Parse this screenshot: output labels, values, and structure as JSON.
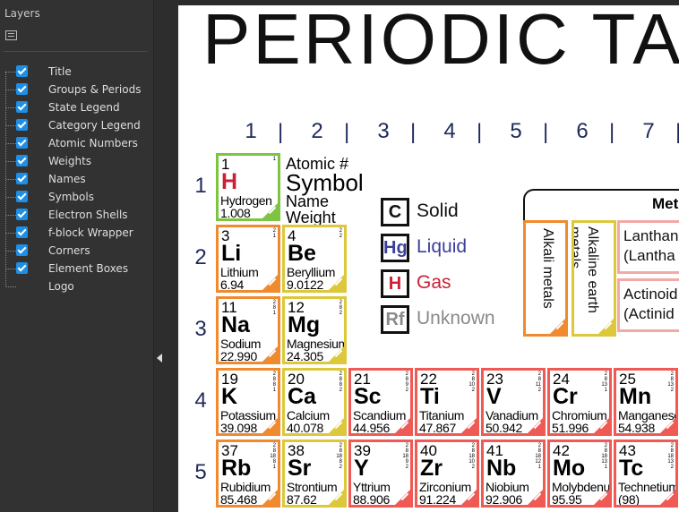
{
  "panel": {
    "title": "Layers",
    "menu_icon": "list-menu-icon",
    "layers": [
      {
        "label": "Title",
        "checked": true
      },
      {
        "label": "Groups & Periods",
        "checked": true
      },
      {
        "label": "State Legend",
        "checked": true
      },
      {
        "label": "Category Legend",
        "checked": true
      },
      {
        "label": "Atomic Numbers",
        "checked": true
      },
      {
        "label": "Weights",
        "checked": true
      },
      {
        "label": "Names",
        "checked": true
      },
      {
        "label": "Symbols",
        "checked": true
      },
      {
        "label": "Electron Shells",
        "checked": true
      },
      {
        "label": "f-block Wrapper",
        "checked": true
      },
      {
        "label": "Corners",
        "checked": true
      },
      {
        "label": "Element Boxes",
        "checked": true
      },
      {
        "label": "Logo",
        "checked": false
      }
    ]
  },
  "splitter": {
    "icon": "collapse-left-arrow-icon"
  },
  "document": {
    "title": "PERIODIC TA",
    "groups": [
      "1",
      "2",
      "3",
      "4",
      "5",
      "6",
      "7"
    ],
    "periods": [
      "1",
      "2",
      "3",
      "4",
      "5"
    ],
    "key": {
      "number": "Atomic #",
      "symbol": "Symbol",
      "name": "Name",
      "weight": "Weight"
    },
    "states": [
      {
        "symbol": "C",
        "label": "Solid",
        "color": "#111111"
      },
      {
        "symbol": "Hg",
        "label": "Liquid",
        "color": "#3b3f9a"
      },
      {
        "symbol": "H",
        "label": "Gas",
        "color": "#cc1f35"
      },
      {
        "symbol": "Rf",
        "label": "Unknown",
        "color": "#8a8a8a"
      }
    ],
    "categories": {
      "header": "Met",
      "alkali": "Alkali metals",
      "alkaline": "Alkaline earth metals",
      "lanthanoids": [
        "Lanthan",
        "(Lantha"
      ],
      "actinoids": [
        "Actinoid",
        "(Actinid"
      ]
    },
    "colors": {
      "alkali": "#f08a2e",
      "alkaline": "#dcc83a",
      "transition": "#ef5a55",
      "nonmetal": "#7cc442",
      "gas": "#cc1f35",
      "group_text": "#1e2a5a"
    },
    "elements": [
      {
        "num": "1",
        "sym": "H",
        "name": "Hydrogen",
        "weight": "1.008",
        "shells": [
          "1"
        ],
        "cat": "nonmetal",
        "gas": true
      },
      {
        "num": "3",
        "sym": "Li",
        "name": "Lithium",
        "weight": "6.94",
        "shells": [
          "2",
          "1"
        ],
        "cat": "alkali"
      },
      {
        "num": "4",
        "sym": "Be",
        "name": "Beryllium",
        "weight": "9.0122",
        "shells": [
          "2",
          "2"
        ],
        "cat": "earth"
      },
      {
        "num": "11",
        "sym": "Na",
        "name": "Sodium",
        "weight": "22.990",
        "shells": [
          "2",
          "8",
          "1"
        ],
        "cat": "alkali"
      },
      {
        "num": "12",
        "sym": "Mg",
        "name": "Magnesium",
        "weight": "24.305",
        "shells": [
          "2",
          "8",
          "2"
        ],
        "cat": "earth"
      },
      {
        "num": "19",
        "sym": "K",
        "name": "Potassium",
        "weight": "39.098",
        "shells": [
          "2",
          "8",
          "8",
          "1"
        ],
        "cat": "alkali"
      },
      {
        "num": "20",
        "sym": "Ca",
        "name": "Calcium",
        "weight": "40.078",
        "shells": [
          "2",
          "8",
          "8",
          "2"
        ],
        "cat": "earth"
      },
      {
        "num": "21",
        "sym": "Sc",
        "name": "Scandium",
        "weight": "44.956",
        "shells": [
          "2",
          "8",
          "9",
          "2"
        ],
        "cat": "trans"
      },
      {
        "num": "22",
        "sym": "Ti",
        "name": "Titanium",
        "weight": "47.867",
        "shells": [
          "2",
          "8",
          "10",
          "2"
        ],
        "cat": "trans"
      },
      {
        "num": "23",
        "sym": "V",
        "name": "Vanadium",
        "weight": "50.942",
        "shells": [
          "2",
          "8",
          "11",
          "2"
        ],
        "cat": "trans"
      },
      {
        "num": "24",
        "sym": "Cr",
        "name": "Chromium",
        "weight": "51.996",
        "shells": [
          "2",
          "8",
          "13",
          "1"
        ],
        "cat": "trans"
      },
      {
        "num": "25",
        "sym": "Mn",
        "name": "Manganese",
        "weight": "54.938",
        "shells": [
          "2",
          "8",
          "13",
          "2"
        ],
        "cat": "trans"
      },
      {
        "num": "37",
        "sym": "Rb",
        "name": "Rubidium",
        "weight": "85.468",
        "shells": [
          "2",
          "8",
          "18",
          "8",
          "1"
        ],
        "cat": "alkali"
      },
      {
        "num": "38",
        "sym": "Sr",
        "name": "Strontium",
        "weight": "87.62",
        "shells": [
          "2",
          "8",
          "18",
          "8",
          "2"
        ],
        "cat": "earth"
      },
      {
        "num": "39",
        "sym": "Y",
        "name": "Yttrium",
        "weight": "88.906",
        "shells": [
          "2",
          "8",
          "18",
          "9",
          "2"
        ],
        "cat": "trans"
      },
      {
        "num": "40",
        "sym": "Zr",
        "name": "Zirconium",
        "weight": "91.224",
        "shells": [
          "2",
          "8",
          "18",
          "10",
          "2"
        ],
        "cat": "trans"
      },
      {
        "num": "41",
        "sym": "Nb",
        "name": "Niobium",
        "weight": "92.906",
        "shells": [
          "2",
          "8",
          "18",
          "12",
          "1"
        ],
        "cat": "trans"
      },
      {
        "num": "42",
        "sym": "Mo",
        "name": "Molybdenum",
        "weight": "95.95",
        "shells": [
          "2",
          "8",
          "18",
          "13",
          "1"
        ],
        "cat": "trans"
      },
      {
        "num": "43",
        "sym": "Tc",
        "name": "Technetium",
        "weight": "(98)",
        "shells": [
          "2",
          "8",
          "18",
          "13",
          "2"
        ],
        "cat": "trans"
      }
    ]
  }
}
